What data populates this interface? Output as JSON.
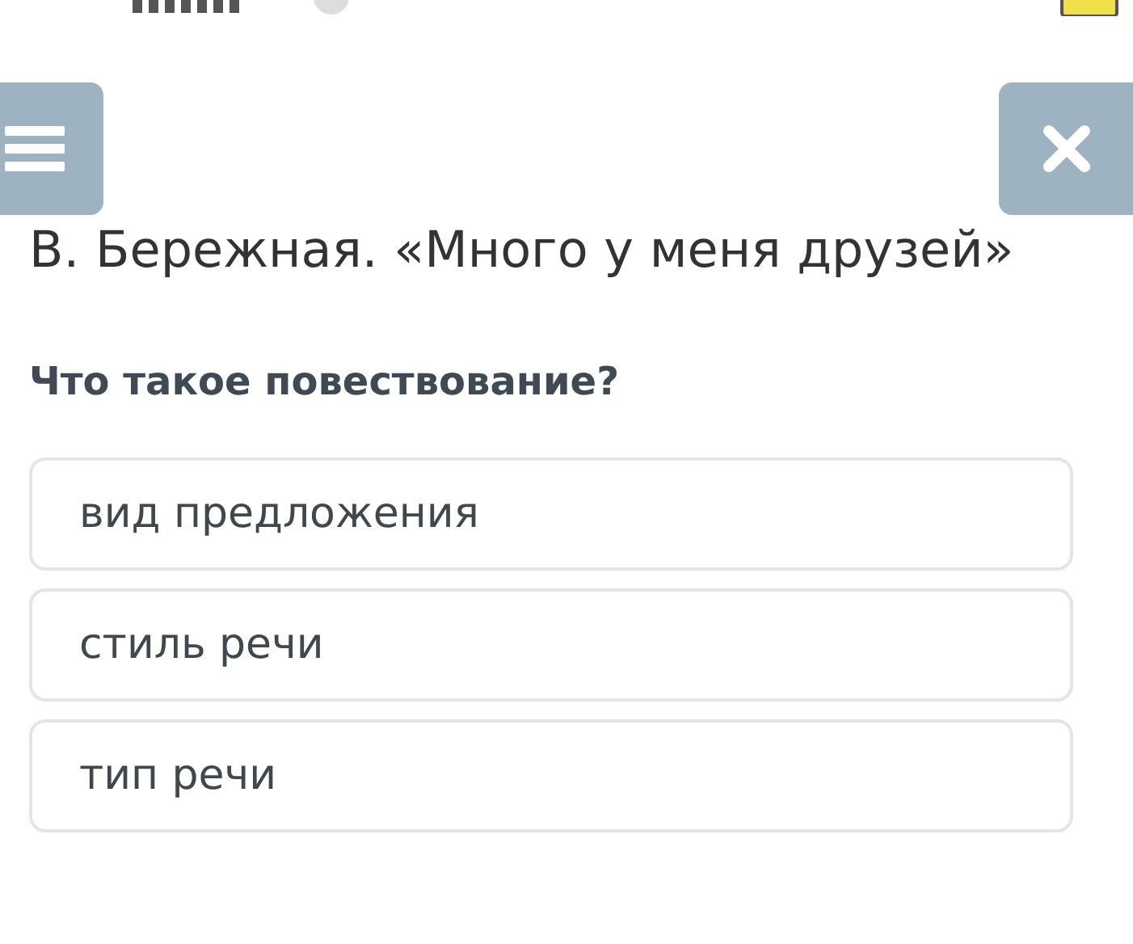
{
  "title": "В. Бережная. «Много у меня друзей»",
  "question": "Что такое повествование?",
  "options": [
    "вид предложения",
    "стиль речи",
    "тип речи"
  ]
}
